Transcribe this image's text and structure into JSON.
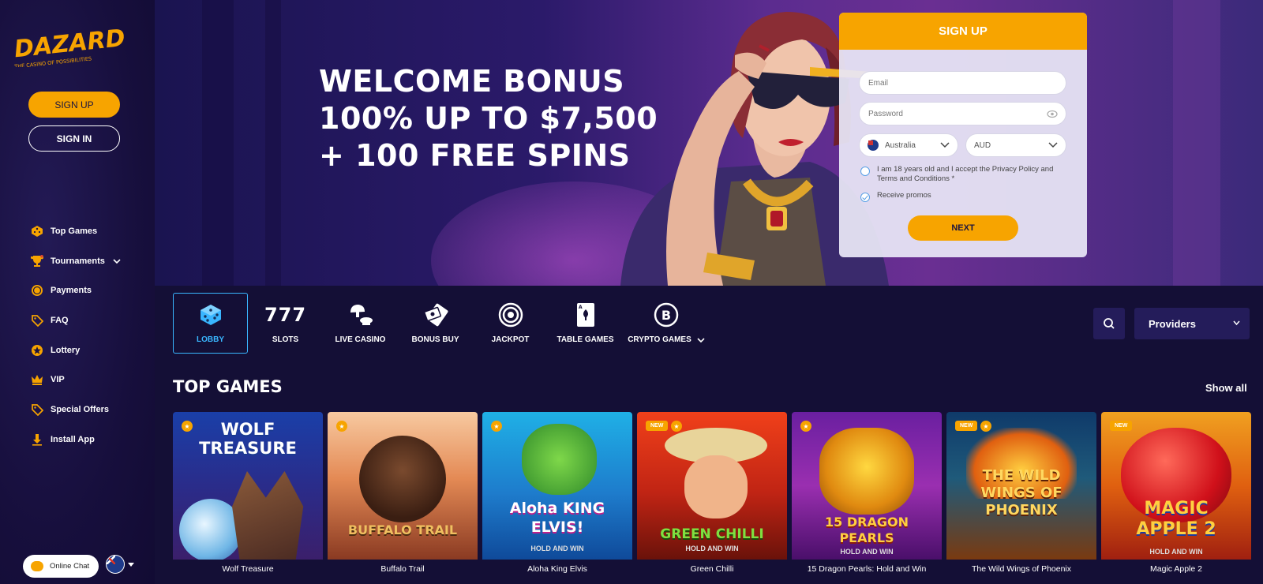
{
  "sidebar": {
    "logo_text": "DAZARD",
    "logo_tagline": "THE CASINO OF POSSIBILITIES",
    "signup_label": "SIGN UP",
    "signin_label": "SIGN IN",
    "nav": [
      {
        "label": "Top Games",
        "icon": "dice-icon"
      },
      {
        "label": "Tournaments",
        "icon": "trophy-icon",
        "has_dropdown": true
      },
      {
        "label": "Payments",
        "icon": "coin-icon"
      },
      {
        "label": "FAQ",
        "icon": "tag-icon"
      },
      {
        "label": "Lottery",
        "icon": "lottery-icon"
      },
      {
        "label": "VIP",
        "icon": "crown-icon"
      },
      {
        "label": "Special Offers",
        "icon": "offer-tag-icon"
      },
      {
        "label": "Install App",
        "icon": "download-icon"
      }
    ],
    "chat_label": "Online Chat"
  },
  "hero": {
    "line1": "WELCOME BONUS",
    "line2": "100% UP TO $7,500",
    "line3": "+ 100 FREE SPINS"
  },
  "signup_form": {
    "title": "SIGN UP",
    "email_placeholder": "Email",
    "password_placeholder": "Password",
    "country": "Australia",
    "currency": "AUD",
    "terms_text": "I am 18 years old and I accept the Privacy Policy and Terms and Conditions *",
    "terms_checked": false,
    "promos_text": "Receive promos",
    "promos_checked": true,
    "next_label": "NEXT"
  },
  "categories": [
    {
      "label": "LOBBY",
      "icon": "dice-icon",
      "active": true
    },
    {
      "label": "SLOTS",
      "icon_text": "777"
    },
    {
      "label": "LIVE CASINO",
      "icon": "mushroom-dealer-icon"
    },
    {
      "label": "BONUS BUY",
      "icon": "cards-money-icon"
    },
    {
      "label": "JACKPOT",
      "icon": "target-icon"
    },
    {
      "label": "TABLE GAMES",
      "icon": "playing-card-icon"
    },
    {
      "label": "CRYPTO GAMES",
      "icon": "bitcoin-icon",
      "has_dropdown": true
    }
  ],
  "providers_label": "Providers",
  "top_games": {
    "title": "TOP GAMES",
    "show_all": "Show all",
    "badge_new": "NEW",
    "items": [
      {
        "name": "Wolf Treasure",
        "art_title": "WOLF TREASURE",
        "art_sub": "",
        "is_new": false
      },
      {
        "name": "Buffalo Trail",
        "art_title": "BUFFALO TRAIL",
        "art_sub": "",
        "is_new": false
      },
      {
        "name": "Aloha King Elvis",
        "art_title": "Aloha KING ELVIS!",
        "art_sub": "HOLD AND WIN",
        "is_new": false
      },
      {
        "name": "Green Chilli",
        "art_title": "GREEN CHILLI",
        "art_sub": "HOLD AND WIN",
        "is_new": true
      },
      {
        "name": "15 Dragon Pearls: Hold and Win",
        "art_title": "15 DRAGON PEARLS",
        "art_sub": "HOLD AND WIN",
        "is_new": false
      },
      {
        "name": "The Wild Wings of Phoenix",
        "art_title": "THE WILD WINGS OF PHOENIX",
        "art_sub": "",
        "is_new": true
      },
      {
        "name": "Magic Apple 2",
        "art_title": "MAGIC APPLE 2",
        "art_sub": "HOLD AND WIN",
        "is_new": true
      }
    ]
  },
  "colors": {
    "accent": "#f7a400",
    "background": "#140f36",
    "active_blue": "#39b6ff"
  }
}
